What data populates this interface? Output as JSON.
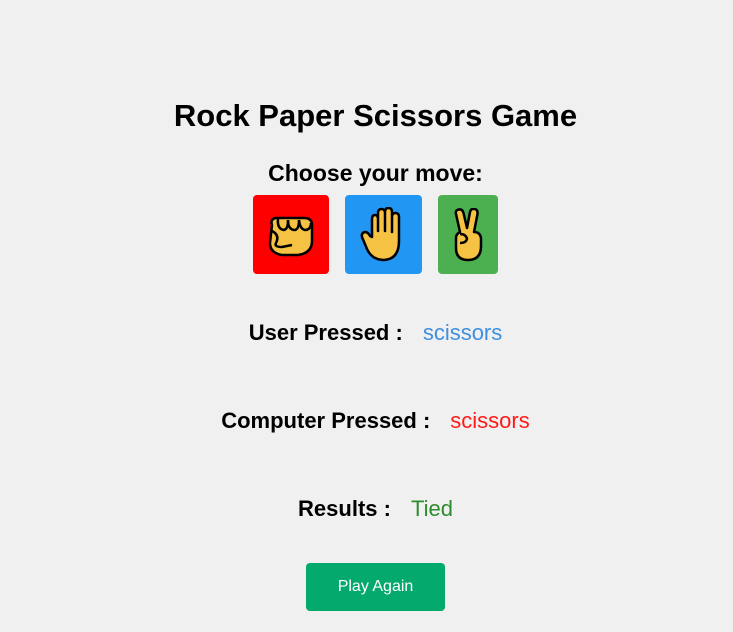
{
  "title": "Rock Paper Scissors Game",
  "prompt": "Choose your move:",
  "moves": [
    {
      "name": "rock",
      "icon": "fist-emoji-icon",
      "color": "#ff0000"
    },
    {
      "name": "paper",
      "icon": "raised-hand-emoji-icon",
      "color": "#2196f3"
    },
    {
      "name": "scissors",
      "icon": "victory-hand-emoji-icon",
      "color": "#4caf50"
    }
  ],
  "user": {
    "label": "User Pressed :",
    "value": "scissors",
    "color": "#3f8fe0"
  },
  "computer": {
    "label": "Computer Pressed :",
    "value": "scissors",
    "color": "#ff1a1a"
  },
  "results": {
    "label": "Results :",
    "value": "Tied",
    "color": "#2e8b2e"
  },
  "play_again": {
    "label": "Play Again",
    "color": "#04a96d"
  }
}
